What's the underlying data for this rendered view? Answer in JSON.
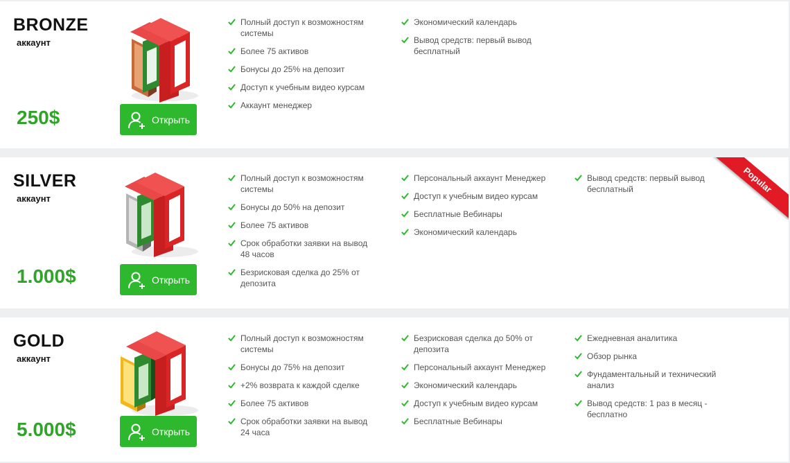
{
  "colors": {
    "accent_green": "#2eb82e",
    "price_green": "#32a32a",
    "ribbon_red": "#e21a26"
  },
  "plans": [
    {
      "name": "BRONZE",
      "subtitle": "аккаунт",
      "price": "250$",
      "button_label": "Открыть",
      "button_icon": "add-user-icon",
      "columns": [
        [
          "Полный доступ к возможностям системы",
          "Более 75 активов",
          "Бонусы до 25% на депозит",
          "Доступ к учебным видео курсам",
          "Аккаунт менеджер"
        ],
        [
          "Экономический календарь",
          "Вывод средств: первый вывод бесплатный"
        ]
      ]
    },
    {
      "name": "SILVER",
      "subtitle": "аккаунт",
      "price": "1.000$",
      "button_label": "Открыть",
      "button_icon": "add-user-icon",
      "ribbon": "Popular",
      "columns": [
        [
          "Полный доступ к возможностям системы",
          "Бонусы до 50% на депозит",
          "Более 75 активов",
          "Срок обработки заявки на вывод 48 часов",
          "Безрисковая сделка до 25% от депозита"
        ],
        [
          "Персональный аккаунт Менеджер",
          "Доступ к учебным видео курсам",
          "Бесплатные Вебинары",
          "Экономический календарь"
        ],
        [
          "Вывод средств: первый вывод бесплатный"
        ]
      ]
    },
    {
      "name": "GOLD",
      "subtitle": "аккаунт",
      "price": "5.000$",
      "button_label": "Открыть",
      "button_icon": "add-user-icon",
      "columns": [
        [
          "Полный доступ к возможностям системы",
          "Бонусы до 75% на депозит",
          "+2% возврата к каждой сделке",
          "Более 75 активов",
          "Срок обработки заявки на вывод 24 часа"
        ],
        [
          "Безрисковая сделка до 50% от депозита",
          "Персональный аккаунт Менеджер",
          "Экономический календарь",
          "Доступ к учебным видео курсам",
          "Бесплатные Вебинары"
        ],
        [
          "Ежедневная аналитика",
          "Обзор рынка",
          "Фундаментальный и технический анализ",
          "Вывод средств: 1 раз в месяц - бесплатно"
        ]
      ]
    }
  ]
}
